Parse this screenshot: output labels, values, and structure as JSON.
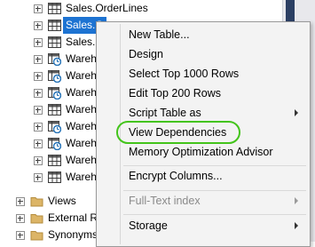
{
  "tree": {
    "rows": [
      {
        "label": "Sales.OrderLines",
        "icon": "table-icon"
      },
      {
        "label": "Sales.Orders",
        "icon": "table-icon"
      },
      {
        "label": "Sales.Sp",
        "icon": "table-icon"
      },
      {
        "label": "Wareh",
        "icon": "temporal-table-icon"
      },
      {
        "label": "Wareh",
        "icon": "temporal-table-icon"
      },
      {
        "label": "Wareh",
        "icon": "temporal-table-icon"
      },
      {
        "label": "Wareh",
        "icon": "table-icon"
      },
      {
        "label": "Wareh",
        "icon": "temporal-table-icon"
      },
      {
        "label": "Wareh",
        "icon": "temporal-table-icon"
      },
      {
        "label": "Wareh",
        "icon": "table-icon"
      },
      {
        "label": "Wareh",
        "icon": "table-icon"
      },
      {
        "label": "Views",
        "icon": "folder-icon"
      },
      {
        "label": "External Re",
        "icon": "folder-icon"
      },
      {
        "label": "Synonyms",
        "icon": "folder-icon"
      }
    ],
    "selected_label": "Sales.O"
  },
  "context_menu": {
    "items": [
      {
        "label": "New Table...",
        "disabled": false,
        "submenu": false
      },
      {
        "label": "Design",
        "disabled": false,
        "submenu": false
      },
      {
        "label": "Select Top 1000 Rows",
        "disabled": false,
        "submenu": false
      },
      {
        "label": "Edit Top 200 Rows",
        "disabled": false,
        "submenu": false
      },
      {
        "label": "Script Table as",
        "disabled": false,
        "submenu": true
      },
      {
        "label": "View Dependencies",
        "disabled": false,
        "submenu": false
      },
      {
        "label": "Memory Optimization Advisor",
        "disabled": false,
        "submenu": false
      },
      {
        "label": "Encrypt Columns...",
        "disabled": false,
        "submenu": false
      },
      {
        "label": "Full-Text index",
        "disabled": true,
        "submenu": true
      },
      {
        "label": "Storage",
        "disabled": false,
        "submenu": true
      }
    ],
    "highlighted_item": "View Dependencies"
  },
  "colors": {
    "selection": "#1d73d2",
    "highlight_ring": "#43c41b",
    "menu_background": "#f3f3f3"
  }
}
